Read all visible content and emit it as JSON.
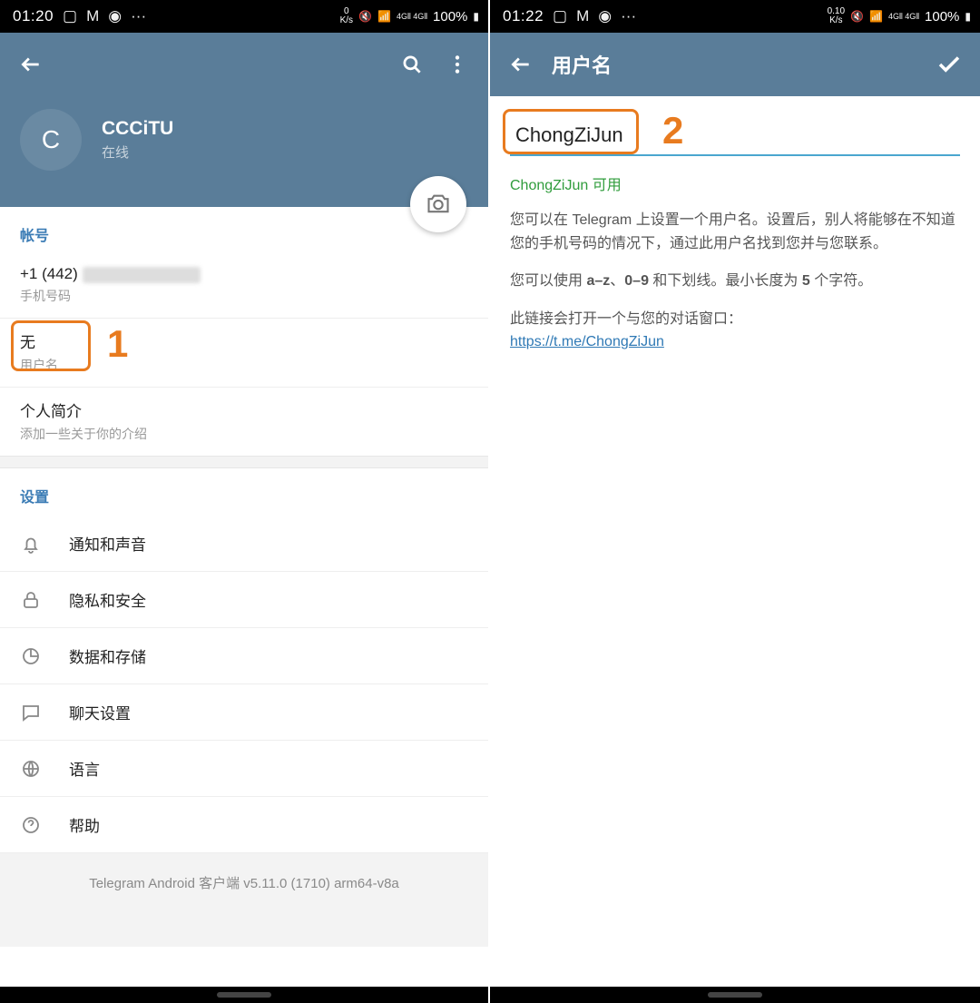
{
  "left": {
    "status": {
      "time": "01:20",
      "net": "0\nK/s",
      "battery": "100%"
    },
    "profile": {
      "initial": "C",
      "name": "CCCiTU",
      "status": "在线"
    },
    "account": {
      "label": "帐号",
      "phone": "+1 (442)",
      "phone_sub": "手机号码",
      "username_val": "无",
      "username_sub": "用户名",
      "bio_title": "个人简介",
      "bio_sub": "添加一些关于你的介绍"
    },
    "settings": {
      "label": "设置",
      "items": [
        {
          "label": "通知和声音"
        },
        {
          "label": "隐私和安全"
        },
        {
          "label": "数据和存储"
        },
        {
          "label": "聊天设置"
        },
        {
          "label": "语言"
        },
        {
          "label": "帮助"
        }
      ]
    },
    "footer": "Telegram Android 客户端 v5.11.0 (1710) arm64-v8a",
    "annotation": "1"
  },
  "right": {
    "status": {
      "time": "01:22",
      "net": "0.10\nK/s",
      "battery": "100%"
    },
    "title": "用户名",
    "input": "ChongZiJun",
    "available": "ChongZiJun 可用",
    "desc1": "您可以在 Telegram 上设置一个用户名。设置后，别人将能够在不知道您的手机号码的情况下，通过此用户名找到您并与您联系。",
    "desc2_pre": "您可以使用 ",
    "desc2_b1": "a–z",
    "desc2_m1": "、",
    "desc2_b2": "0–9",
    "desc2_m2": " 和下划线。最小长度为 ",
    "desc2_b3": "5",
    "desc2_m3": " 个字符。",
    "desc3": "此链接会打开一个与您的对话窗口：",
    "link": "https://t.me/ChongZiJun",
    "annotation": "2"
  }
}
